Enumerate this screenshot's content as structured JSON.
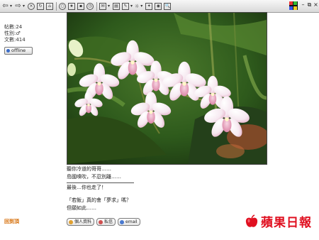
{
  "toolbar": {
    "find_label": "🔍",
    "icons": [
      "back-arrow-icon",
      "forward-arrow-icon",
      "stop-icon",
      "refresh-icon",
      "home-icon",
      "search-icon",
      "favorites-icon",
      "history-icon",
      "mail-icon",
      "print-icon",
      "edit-icon",
      "discuss-icon",
      "messenger-icon"
    ]
  },
  "profile": {
    "posts": "帖數:24",
    "gender": "性別:♂",
    "credits": "文數:414",
    "status": "offline"
  },
  "post": {
    "line1": "聽你冷道的哥哥……",
    "line2": "島國嗅吹，不忍別離……",
    "line3": "最後…你也走了！",
    "line4": "「若飯」真的會「夢求」嗎？",
    "line5": "但願如此……"
  },
  "reply_label": "回到頂",
  "buttons": {
    "profile": "個人資料",
    "pm": "私信",
    "email": "email"
  },
  "watermark": "蘋果日報",
  "colors": {
    "accent": "#d46a00",
    "brand_red": "#e01020"
  }
}
